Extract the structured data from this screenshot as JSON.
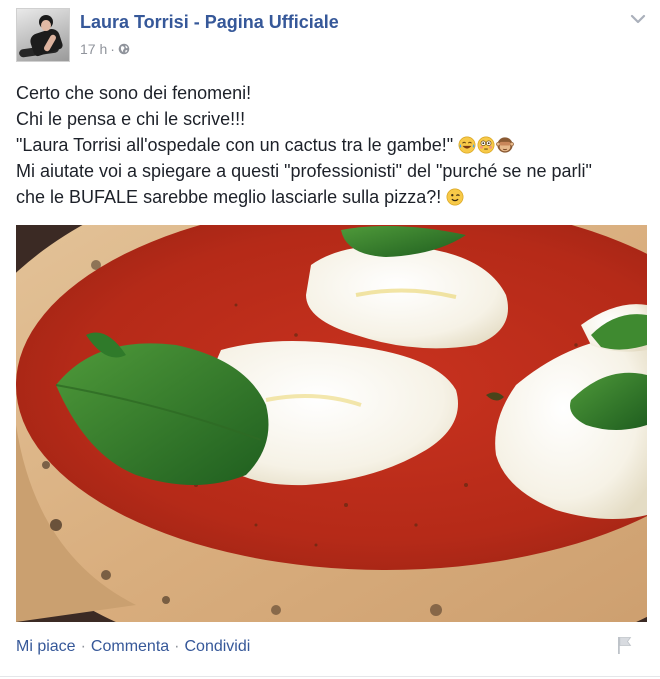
{
  "post": {
    "author": "Laura Torrisi - Pagina Ufficiale",
    "time": "17 h",
    "time_separator": "·",
    "text_lines": [
      "Certo che sono dei fenomeni!",
      "Chi le pensa e chi le scrive!!!",
      "\"Laura Torrisi all'ospedale con un cactus tra le gambe!\"",
      "Mi aiutate voi a spiegare a questi \"professionisti\" del \"purché se ne parli\"",
      "che le BUFALE sarebbe meglio lasciarle sulla pizza?!"
    ],
    "line3_emojis": [
      "laughing-tears-emoji",
      "flushed-emoji",
      "see-no-evil-monkey-emoji"
    ],
    "line5_emoji": "wink-emoji"
  },
  "actions": {
    "like": "Mi piace",
    "comment": "Commenta",
    "share": "Condividi",
    "separator": "·"
  },
  "icons": {
    "audience": "globe-icon",
    "menu": "chevron-down-icon",
    "report": "flag-icon"
  },
  "colors": {
    "link": "#365899",
    "meta": "#90949c",
    "text": "#1d2129"
  }
}
